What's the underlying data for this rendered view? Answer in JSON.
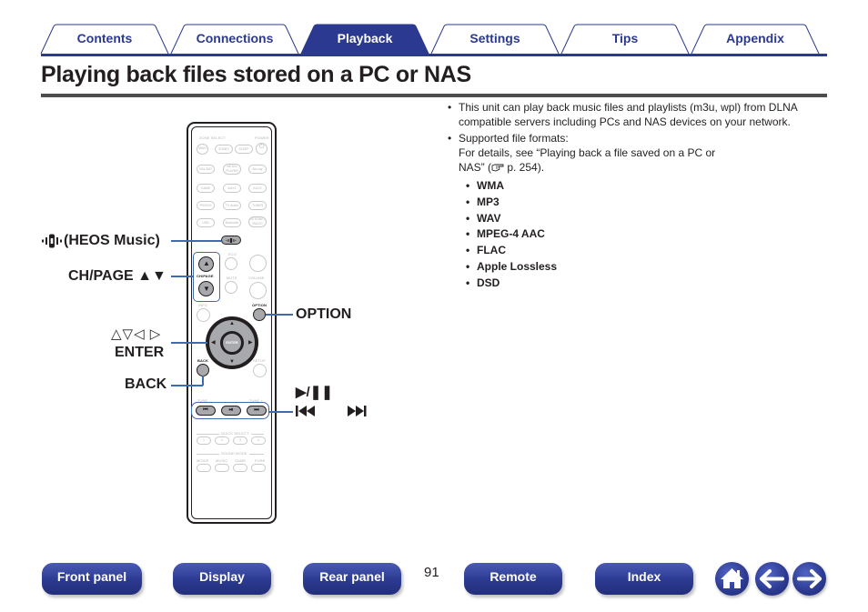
{
  "tabs": [
    {
      "label": "Contents",
      "active": false
    },
    {
      "label": "Connections",
      "active": false
    },
    {
      "label": "Playback",
      "active": true
    },
    {
      "label": "Settings",
      "active": false
    },
    {
      "label": "Tips",
      "active": false
    },
    {
      "label": "Appendix",
      "active": false
    }
  ],
  "page": {
    "title": "Playing back files stored on a PC or NAS",
    "number": "91"
  },
  "content": {
    "bullet1": "This unit can play back music files and playlists (m3u, wpl) from DLNA compatible servers including PCs and NAS devices on your network.",
    "bullet2_line1": "Supported file formats:",
    "bullet2_line2": "For details, see “Playing back a file saved on a PC or NAS” (",
    "bullet2_ref": "p. 254).",
    "formats": [
      "WMA",
      "MP3",
      "WAV",
      "MPEG-4 AAC",
      "FLAC",
      "Apple Lossless",
      "DSD"
    ]
  },
  "remote": {
    "zone_select": "ZONE SELECT",
    "power": "POWER",
    "zone_buttons": [
      "MAIN",
      "ZONE2",
      "SLEEP"
    ],
    "source_rows": [
      [
        "CBL/SAT",
        "MEDIA PLAYER",
        "Blu-ray"
      ],
      [
        "GAME",
        "AUX1",
        "AUX2"
      ],
      [
        "PHONO",
        "TV Audio",
        "TUNER"
      ],
      [
        "USB",
        "Bluetooth",
        "INTERNET RADIO"
      ]
    ],
    "heos_label": "HEOS",
    "ch_page": "CH/PAGE",
    "eco": "ECO",
    "mute": "MUTE",
    "volume": "VOLUME",
    "info": "INFO",
    "option": "OPTION",
    "enter": "ENTER",
    "back": "BACK",
    "setup": "SETUP",
    "tune_minus": "TUNE -",
    "tune_plus": "TUNE +",
    "quick_select": "QUICK SELECT",
    "quick_buttons": [
      "1",
      "2",
      "3",
      "4"
    ],
    "sound_mode": "SOUND MODE",
    "sound_buttons": [
      "MOVIE",
      "MUSIC",
      "GAME",
      "PURE"
    ]
  },
  "callouts": {
    "heos": "(HEOS Music)",
    "ch_page": "CH/PAGE ▲▼",
    "cursor_arrows": "△▽◁ ▷",
    "enter": "ENTER",
    "back": "BACK",
    "option": "OPTION",
    "play_pause": "▶/❚❚",
    "skip": "◀◀ ▶▶"
  },
  "bottom_nav": {
    "front_panel": "Front panel",
    "display": "Display",
    "rear_panel": "Rear panel",
    "remote": "Remote",
    "index": "Index"
  },
  "icons": {
    "home": "home-icon",
    "back": "arrow-left-icon",
    "forward": "arrow-right-icon",
    "heos": "heos-icon",
    "reference": "reference-hand-icon"
  },
  "colors": {
    "brand_blue": "#2b3990",
    "callout_line": "#3d6bb3",
    "title_rule": "#4d4d4f"
  }
}
